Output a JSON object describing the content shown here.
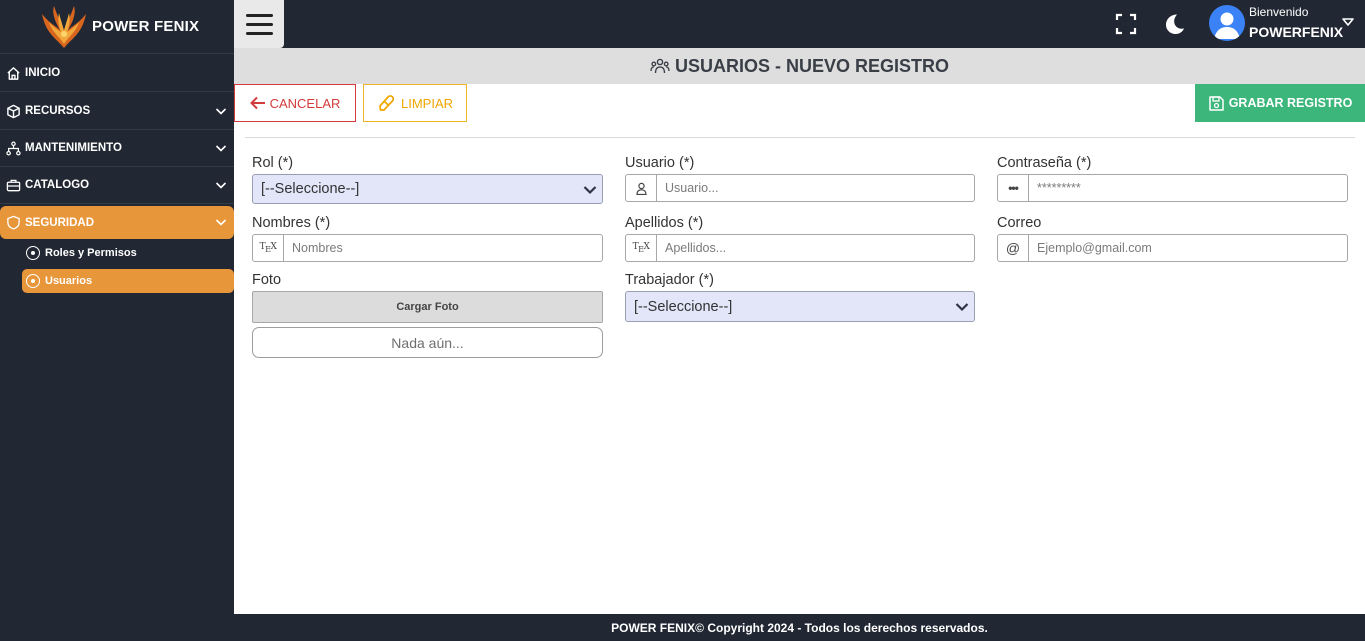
{
  "brand": {
    "name": "POWER FENIX"
  },
  "sidebar": {
    "items": [
      {
        "label": "INICIO",
        "icon": "home-icon"
      },
      {
        "label": "RECURSOS",
        "icon": "box-icon"
      },
      {
        "label": "MANTENIMIENTO",
        "icon": "network-icon"
      },
      {
        "label": "CATALOGO",
        "icon": "briefcase-icon"
      },
      {
        "label": "SEGURIDAD",
        "icon": "shield-icon",
        "active": true
      }
    ],
    "subitems": [
      {
        "label": "Roles y Permisos"
      },
      {
        "label": "Usuarios",
        "active": true
      }
    ]
  },
  "user": {
    "greeting": "Bienvenido",
    "name": "POWERFENIX"
  },
  "page": {
    "title": "USUARIOS - NUEVO REGISTRO"
  },
  "actions": {
    "cancel": "CANCELAR",
    "clear": "LIMPIAR",
    "save": "GRABAR REGISTRO"
  },
  "form": {
    "rol": {
      "label": "Rol (*)",
      "value": "[--Seleccione--]"
    },
    "usuario": {
      "label": "Usuario (*)",
      "placeholder": "Usuario..."
    },
    "contrasena": {
      "label": "Contraseña (*)",
      "placeholder": "*********"
    },
    "nombres": {
      "label": "Nombres (*)",
      "placeholder": "Nombres"
    },
    "apellidos": {
      "label": "Apellidos (*)",
      "placeholder": "Apellidos..."
    },
    "correo": {
      "label": "Correo",
      "placeholder": "Ejemplo@gmail.com"
    },
    "foto": {
      "label": "Foto",
      "button": "Cargar Foto",
      "status": "Nada aún..."
    },
    "trabajador": {
      "label": "Trabajador (*)",
      "value": "[--Seleccione--]"
    }
  },
  "footer": {
    "text": "POWER FENIX© Copyright 2024 - Todos los derechos reservados."
  },
  "colors": {
    "sidebar": "#222833",
    "accent": "#e8963a",
    "danger": "#d33b3b",
    "warning": "#f0a500",
    "success": "#3cb67b",
    "select_bg": "#e3e6f9"
  }
}
